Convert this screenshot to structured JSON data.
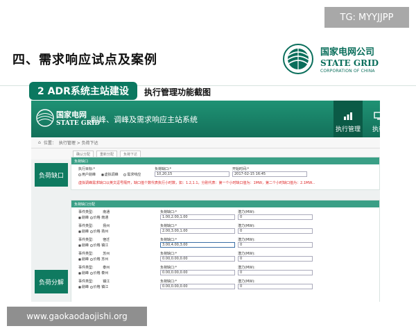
{
  "slide": {
    "title": "四、需求响应试点及案例",
    "section_tag": "2 ADR系统主站建设",
    "section_subtitle": "执行管理功能截图"
  },
  "badge": {
    "text": "TG: MYYJJPP"
  },
  "brand": {
    "cn": "国家电网公司",
    "en": "STATE GRID",
    "en_sub": "CORPORATION OF CHINA",
    "color": "#0a6e5b"
  },
  "watermark": {
    "text": "www.gaokaodaojishi.org"
  },
  "app": {
    "logo_cn": "国家电网",
    "logo_en": "STATE GRID",
    "system_title": "削峰、调峰及需求响应主站系统",
    "tabs": [
      {
        "label": "执行管理"
      },
      {
        "label": "执行"
      }
    ],
    "breadcrumb": {
      "prefix": "位置：",
      "path": "执行管理 > 负荷下达"
    },
    "toolbar": {
      "btn1": "确认分配",
      "btn2": "重新分配",
      "btn3": "负荷下达"
    },
    "side_labels": {
      "gap": "负荷缺口",
      "decompose": "负荷分解"
    },
    "gap_panel": {
      "header": "负荷缺口",
      "target_label": "执行目标:*",
      "target_options": [
        "用户削峰",
        "虚拟调峰",
        "需求响应"
      ],
      "gap_label": "负荷缺口:*",
      "gap_value": "10,20,15",
      "time_label": "开始时间:*",
      "time_value": "2017-02-15 16:45",
      "warning": "虚拟调峰需求缺口以英文逗号隔开，缺口值个数代表执行小时数，如：1.2,1.1，分别代表：第一个小时缺口值为：1MW，第二个小时缺口值为：2.1MW..."
    },
    "decompose_panel": {
      "header": "负荷缺口分配",
      "labels": {
        "event_type": "事件类型:",
        "gap": "负荷缺口:*",
        "capacity": "潜力(MW):"
      },
      "type_options": [
        "削峰",
        "价格"
      ],
      "rows": [
        {
          "city": "南通",
          "city2": "南通",
          "gap": "1.00,2.00,1.00",
          "capacity": "0"
        },
        {
          "city": "扬州",
          "city2": "扬州",
          "gap": "2.00,3.00,1.00",
          "capacity": "0"
        },
        {
          "city": "宿迁",
          "city2": "镇江",
          "gap": "3.00,4.00,3.00",
          "capacity": "0"
        },
        {
          "city": "苏州",
          "city2": "苏州",
          "gap": "0.00,0.00,0.00",
          "capacity": "0"
        },
        {
          "city": "泰州",
          "city2": "泰州",
          "gap": "0.00,0.00,0.00",
          "capacity": "0"
        },
        {
          "city": "镇江",
          "city2": "镇江",
          "gap": "0.00,0.00,0.00",
          "capacity": "0"
        }
      ]
    }
  }
}
